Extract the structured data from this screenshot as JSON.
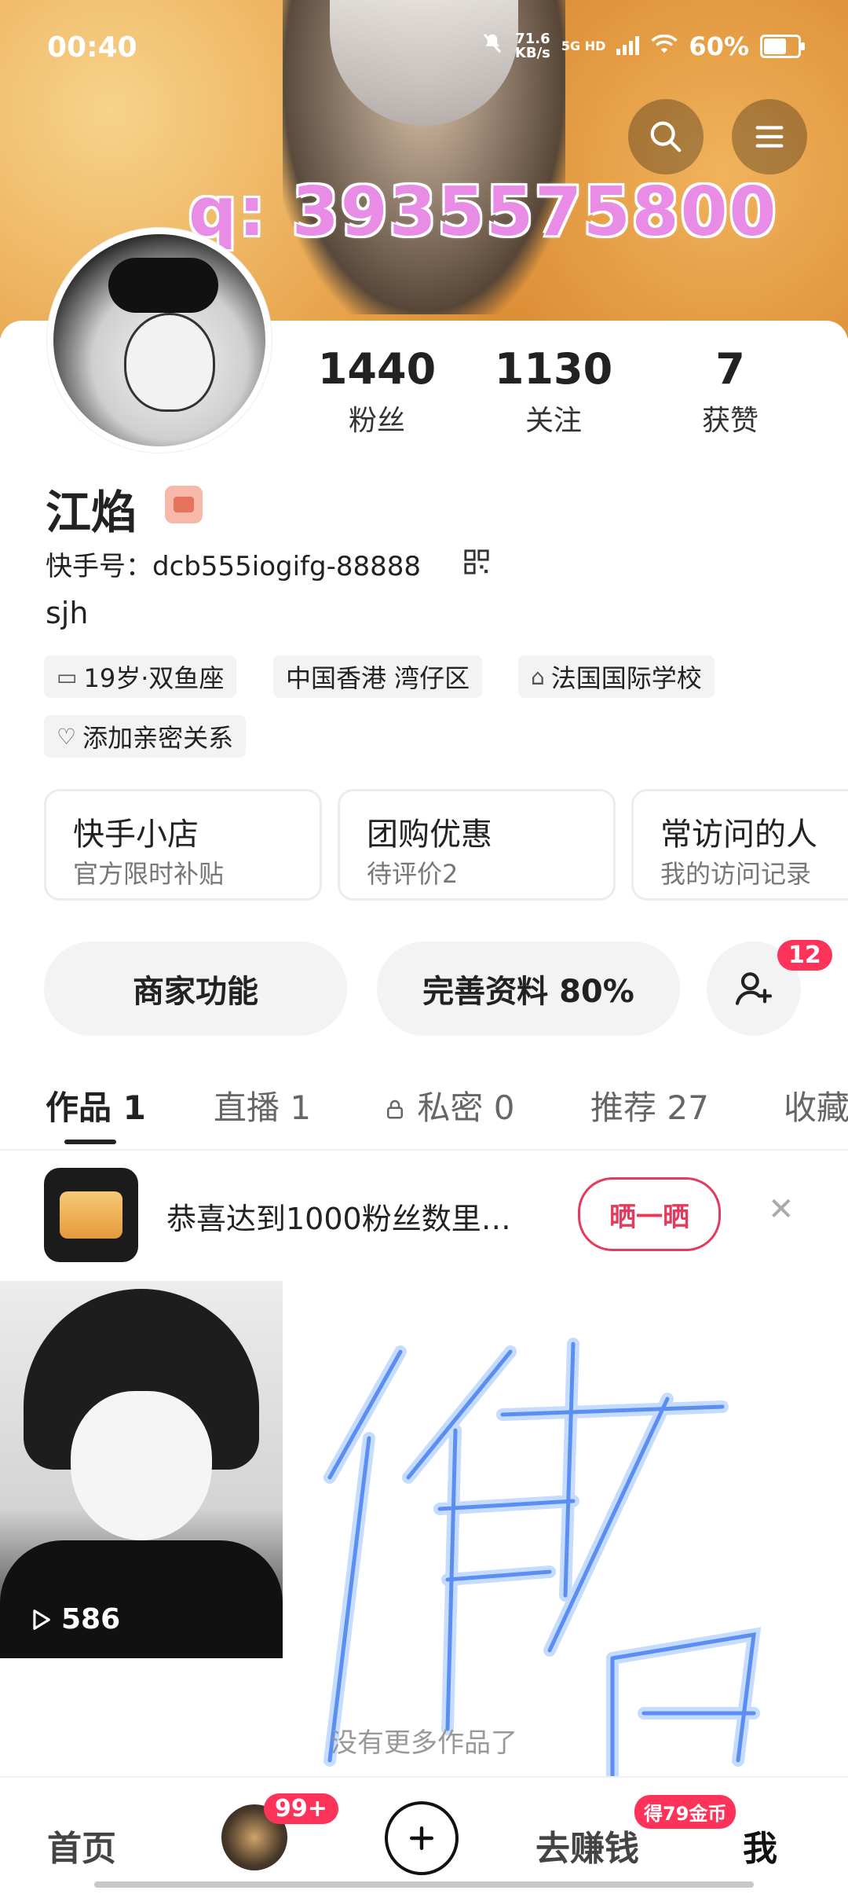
{
  "status_bar": {
    "time": "00:40",
    "speed": "71.6",
    "speed_unit": "KB/s",
    "network": "5G HD",
    "battery": "60%"
  },
  "banner": {
    "overlay_text": "q: 3935575800"
  },
  "profile": {
    "name": "江焰",
    "kuaishou_id": "快手号：dcb555iogifg-88888",
    "bio": "sjh",
    "stats": [
      {
        "value": "1440",
        "label": "粉丝"
      },
      {
        "value": "1130",
        "label": "关注"
      },
      {
        "value": "7",
        "label": "获赞"
      }
    ],
    "tags": [
      {
        "icon": "calendar-icon",
        "label": "19岁·双鱼座"
      },
      {
        "icon": "",
        "label": "中国香港 湾仔区"
      },
      {
        "icon": "school-icon",
        "label": "法国国际学校"
      },
      {
        "icon": "link-hearts-icon",
        "label": "添加亲密关系"
      }
    ]
  },
  "shortcut_cards": [
    {
      "title": "快手小店",
      "subtitle": "官方限时补贴"
    },
    {
      "title": "团购优惠",
      "subtitle": "待评价2"
    },
    {
      "title": "常访问的人",
      "subtitle": "我的访问记录"
    }
  ],
  "actions": {
    "merchant": "商家功能",
    "complete_profile": "完善资料 80%",
    "friend_requests_badge": "12"
  },
  "tabs": [
    "作品 1",
    "直播 1",
    "私密 0",
    "推荐 27",
    "收藏"
  ],
  "promo": {
    "text": "恭喜达到1000粉丝数里…",
    "button": "晒一晒"
  },
  "works": [
    {
      "plays": "586"
    }
  ],
  "footer_note": "没有更多作品了",
  "bottom_nav": {
    "home": "首页",
    "follow_badge": "99+",
    "earn": "去赚钱",
    "earn_badge": "得79金币",
    "me": "我"
  },
  "colors": {
    "accent_red": "#fe3359",
    "promo_button": "#e43a5b",
    "overlay_pink": "#e88ce6"
  }
}
